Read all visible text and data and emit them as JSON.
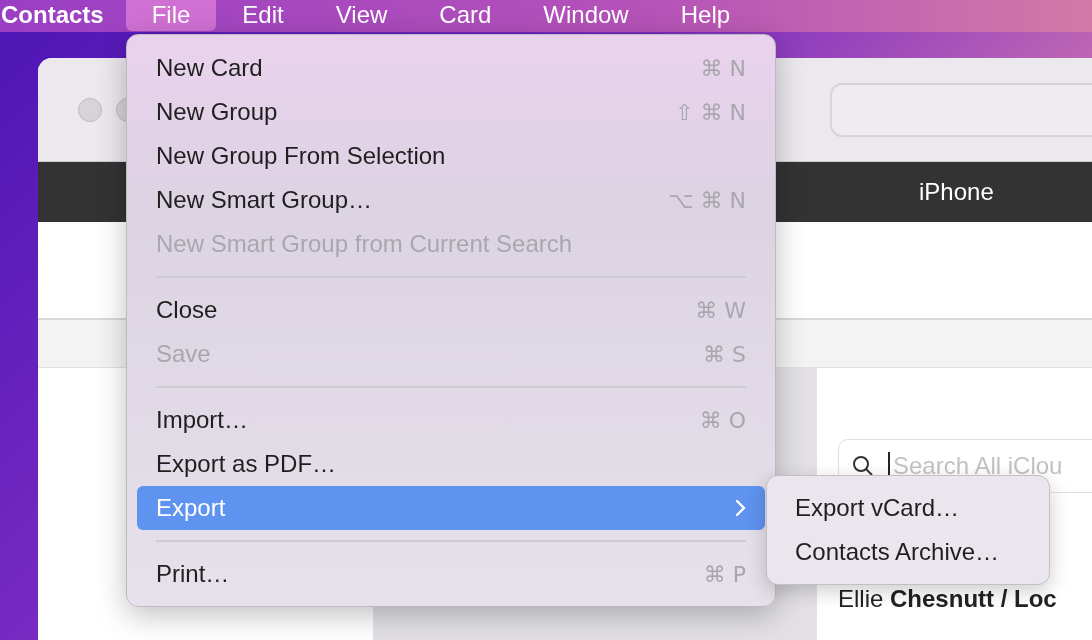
{
  "menu_bar": {
    "app_name": "Contacts",
    "menus": [
      {
        "label": "File",
        "selected": true
      },
      {
        "label": "Edit",
        "selected": false
      },
      {
        "label": "View",
        "selected": false
      },
      {
        "label": "Card",
        "selected": false
      },
      {
        "label": "Window",
        "selected": false
      },
      {
        "label": "Help",
        "selected": false
      }
    ]
  },
  "file_menu": {
    "items": [
      {
        "kind": "item",
        "label": "New Card",
        "shortcut": "⌘ N",
        "disabled": false,
        "selected": false
      },
      {
        "kind": "item",
        "label": "New Group",
        "shortcut": "⇧ ⌘ N",
        "disabled": false,
        "selected": false
      },
      {
        "kind": "item",
        "label": "New Group From Selection",
        "disabled": false,
        "selected": false
      },
      {
        "kind": "item",
        "label": "New Smart Group…",
        "shortcut": "⌥ ⌘ N",
        "disabled": false,
        "selected": false
      },
      {
        "kind": "item",
        "label": "New Smart Group from Current Search",
        "disabled": true,
        "selected": false
      },
      {
        "kind": "separator"
      },
      {
        "kind": "item",
        "label": "Close",
        "shortcut": "⌘ W",
        "disabled": false,
        "selected": false
      },
      {
        "kind": "item",
        "label": "Save",
        "shortcut": "⌘ S",
        "disabled": true,
        "selected": false
      },
      {
        "kind": "separator"
      },
      {
        "kind": "item",
        "label": "Import…",
        "shortcut": "⌘ O",
        "disabled": false,
        "selected": false
      },
      {
        "kind": "item",
        "label": "Export as PDF…",
        "disabled": false,
        "selected": false
      },
      {
        "kind": "submenu",
        "label": "Export",
        "disabled": false,
        "selected": true
      },
      {
        "kind": "separator"
      },
      {
        "kind": "item",
        "label": "Print…",
        "shortcut": "⌘ P",
        "disabled": false,
        "selected": false
      }
    ]
  },
  "export_submenu": {
    "items": [
      {
        "label": "Export vCard…"
      },
      {
        "label": "Contacts Archive…"
      }
    ]
  },
  "window": {
    "device_bar": {
      "label": "iPhone"
    },
    "search": {
      "placeholder": "Search All iClou"
    },
    "contact_row": {
      "name": "Ellie **Chesnutt / Loc**"
    }
  }
}
